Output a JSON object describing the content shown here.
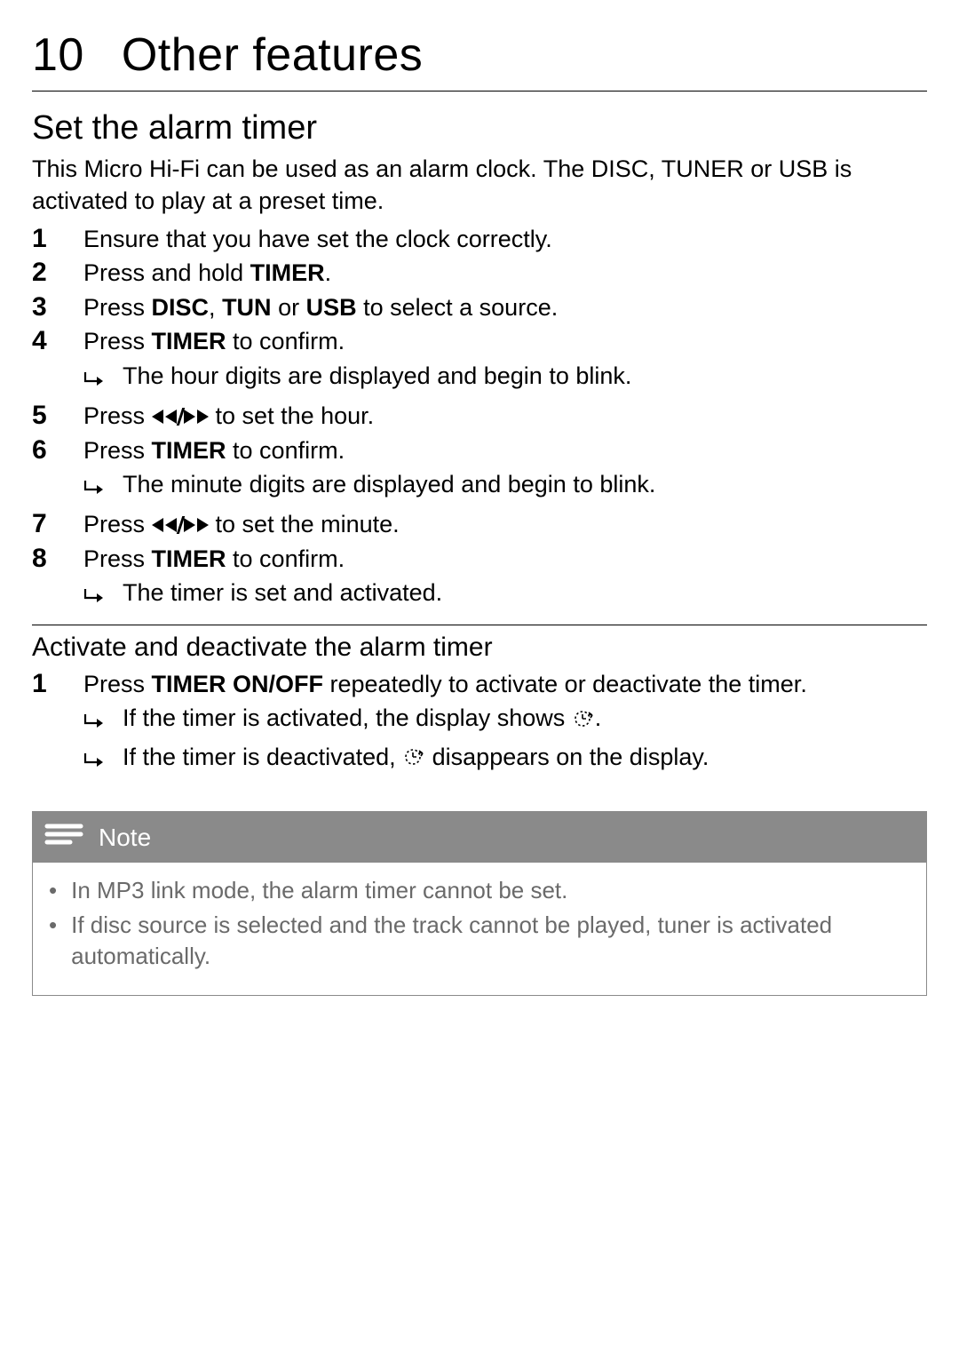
{
  "chapter": {
    "number": "10",
    "title": "Other features"
  },
  "section1": {
    "title": "Set the alarm timer",
    "intro": "This Micro Hi-Fi can be used as an alarm clock. The DISC, TUNER or USB is activated to play at a preset time.",
    "steps": {
      "s1": "Ensure that you have set the clock correctly.",
      "s2_a": "Press and hold ",
      "s2_b": "TIMER",
      "s2_c": ".",
      "s3_a": "Press ",
      "s3_b": "DISC",
      "s3_c": ", ",
      "s3_d": "TUN",
      "s3_e": " or ",
      "s3_f": "USB",
      "s3_g": " to select a source.",
      "s4_a": "Press ",
      "s4_b": "TIMER",
      "s4_c": " to confirm.",
      "s4_r": "The hour digits are displayed and begin to blink.",
      "s5_a": "Press ",
      "s5_b": " to set the hour.",
      "s6_a": "Press ",
      "s6_b": "TIMER",
      "s6_c": " to confirm.",
      "s6_r": "The minute digits are displayed and begin to blink.",
      "s7_a": "Press ",
      "s7_b": " to set the minute.",
      "s8_a": "Press ",
      "s8_b": "TIMER",
      "s8_c": " to confirm.",
      "s8_r": "The timer is set and activated."
    }
  },
  "section2": {
    "title": "Activate and deactivate the alarm timer",
    "s1_a": "Press ",
    "s1_b": "TIMER ON/OFF",
    "s1_c": " repeatedly to activate or deactivate the timer.",
    "r1_a": "If the timer is activated, the display shows ",
    "r1_b": ".",
    "r2_a": "If the timer is deactivated, ",
    "r2_b": " disappears on the display."
  },
  "note": {
    "label": "Note",
    "n1": "In MP3 link mode, the alarm timer cannot be set.",
    "n2": "If disc source is selected and the track cannot be played, tuner is activated automatically."
  }
}
